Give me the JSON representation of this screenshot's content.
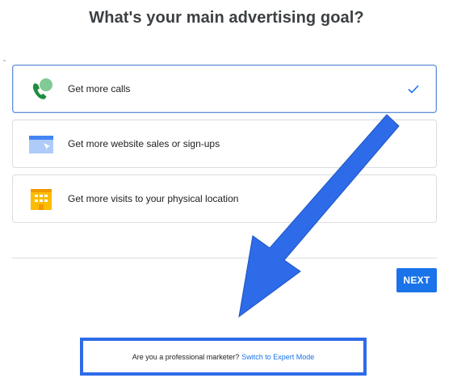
{
  "page": {
    "title": "What's your main advertising goal?"
  },
  "options": [
    {
      "label": "Get more calls",
      "icon": "phone-chat-icon",
      "selected": true
    },
    {
      "label": "Get more website sales or sign-ups",
      "icon": "browser-window-icon",
      "selected": false
    },
    {
      "label": "Get more visits to your physical location",
      "icon": "storefront-icon",
      "selected": false
    }
  ],
  "actions": {
    "next_label": "NEXT"
  },
  "footer": {
    "prompt": "Are you a professional marketer?",
    "link_label": "Switch to Expert Mode"
  },
  "colors": {
    "primary": "#1a73e8",
    "annotation_blue": "#2d6be8",
    "border": "#dadce0",
    "selected_border": "#5f8fd6"
  }
}
